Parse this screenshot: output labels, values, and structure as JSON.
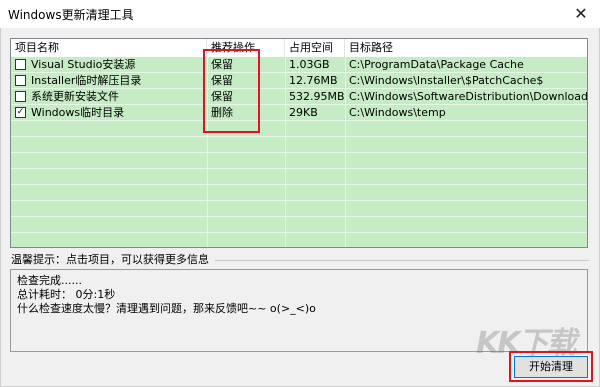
{
  "window": {
    "title": "Windows更新清理工具",
    "close_glyph": "✕"
  },
  "table": {
    "columns": [
      "项目名称",
      "推荐操作",
      "占用空间",
      "目标路径"
    ],
    "rows": [
      {
        "checked": false,
        "name": "Visual Studio安装源",
        "action": "保留",
        "size": "1.03GB",
        "path": "C:\\ProgramData\\Package Cache"
      },
      {
        "checked": false,
        "name": "Installer临时解压目录",
        "action": "保留",
        "size": "12.76MB",
        "path": "C:\\Windows\\Installer\\$PatchCache$"
      },
      {
        "checked": false,
        "name": "系统更新安装文件",
        "action": "保留",
        "size": "532.95MB",
        "path": "C:\\Windows\\SoftwareDistribution\\Download"
      },
      {
        "checked": true,
        "name": "Windows临时目录",
        "action": "删除",
        "size": "29KB",
        "path": "C:\\Windows\\temp"
      }
    ]
  },
  "hint": "温馨提示：点击项目，可以获得更多信息",
  "log": {
    "lines": [
      "检查完成......",
      "总计耗时： 0分:1秒",
      "什么检查速度太慢？清理遇到问题，那来反馈吧~~ o(>_<)o"
    ]
  },
  "start_button_label": "开始清理",
  "colors": {
    "row_background": "#c6ecc6",
    "highlight_box": "#e0141e"
  }
}
